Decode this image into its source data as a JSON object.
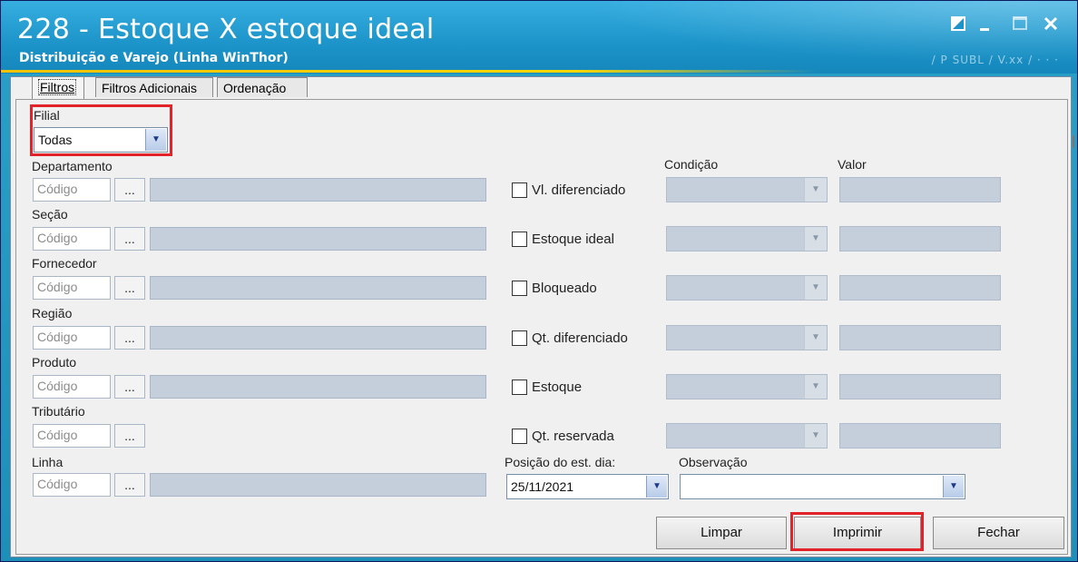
{
  "window": {
    "title": "228 - Estoque X estoque ideal",
    "subtitle": "Distribuição e Varejo (Linha WinThor)",
    "version_text": "/  P SUBL / V.xx / · · ·",
    "controls": [
      "restore-icon",
      "minimize-icon",
      "maximize-icon",
      "close-icon"
    ]
  },
  "tabs": [
    {
      "label": "Filtros",
      "active": true
    },
    {
      "label": "Filtros Adicionais",
      "active": false
    },
    {
      "label": "Ordenação",
      "active": false
    }
  ],
  "filial": {
    "label": "Filial",
    "value": "Todas"
  },
  "left_fields": [
    {
      "label": "Departamento",
      "placeholder": "Código",
      "button": "...",
      "has_desc": true
    },
    {
      "label": "Seção",
      "placeholder": "Código",
      "button": "...",
      "has_desc": true
    },
    {
      "label": "Fornecedor",
      "placeholder": "Código",
      "button": "...",
      "has_desc": true
    },
    {
      "label": "Região",
      "placeholder": "Código",
      "button": "...",
      "has_desc": true
    },
    {
      "label": "Produto",
      "placeholder": "Código",
      "button": "...",
      "has_desc": true
    },
    {
      "label": "Tributário",
      "placeholder": "Código",
      "button": "...",
      "has_desc": false
    },
    {
      "label": "Linha",
      "placeholder": "Código",
      "button": "...",
      "has_desc": true
    }
  ],
  "condition_header": "Condição",
  "value_header": "Valor",
  "checks": [
    {
      "label": "Vl. diferenciado",
      "checked": false
    },
    {
      "label": "Estoque ideal",
      "checked": false
    },
    {
      "label": "Bloqueado",
      "checked": false
    },
    {
      "label": "Qt. diferenciado",
      "checked": false
    },
    {
      "label": "Estoque",
      "checked": false
    },
    {
      "label": "Qt. reservada",
      "checked": false
    }
  ],
  "posicao": {
    "label": "Posição do est. dia:",
    "value": "25/11/2021"
  },
  "observacao": {
    "label": "Observação",
    "value": ""
  },
  "buttons": {
    "limpar": "Limpar",
    "imprimir": "Imprimir",
    "fechar": "Fechar"
  },
  "colors": {
    "title_bar": "#1c94c9",
    "highlight": "#e2242a",
    "disabled_field": "#c4cfdb"
  }
}
